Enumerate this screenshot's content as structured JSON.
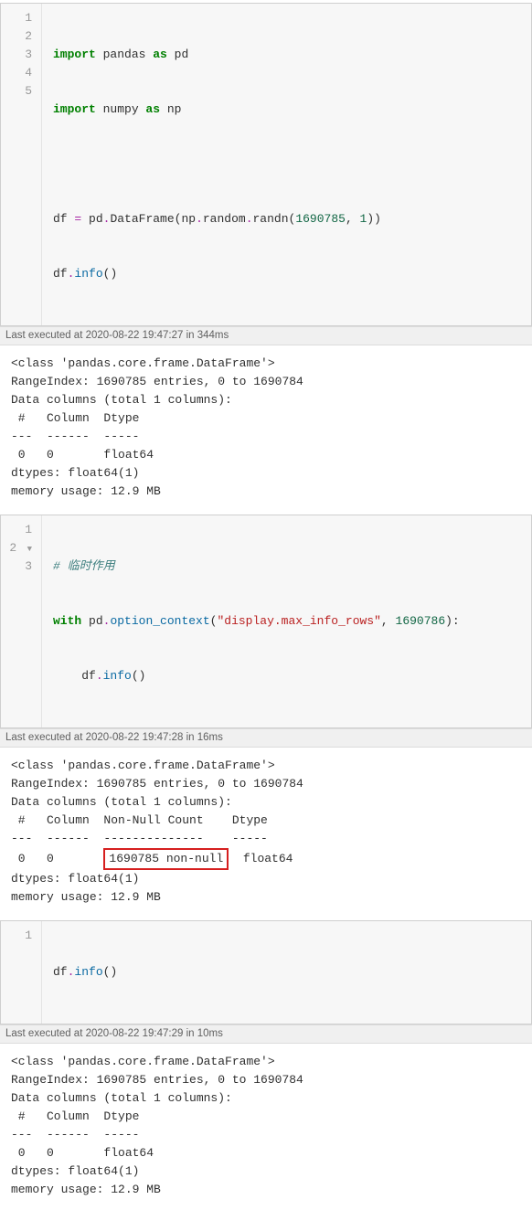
{
  "cell1": {
    "lines": [
      "1",
      "2",
      "3",
      "4",
      "5"
    ],
    "code": {
      "l1a": "import",
      "l1b": " pandas ",
      "l1c": "as",
      "l1d": " pd",
      "l2a": "import",
      "l2b": " numpy ",
      "l2c": "as",
      "l2d": " np",
      "l4a": "df ",
      "l4b": "=",
      "l4c": " pd",
      "l4d": ".",
      "l4e": "DataFrame",
      "l4f": "(np",
      "l4g": ".",
      "l4h": "random",
      "l4i": ".",
      "l4j": "randn",
      "l4k": "(",
      "l4l": "1690785",
      "l4m": ", ",
      "l4n": "1",
      "l4o": "))",
      "l5a": "df",
      "l5b": ".",
      "l5c": "info",
      "l5d": "()"
    },
    "exec": "Last executed at 2020-08-22 19:47:27 in 344ms",
    "output": "<class 'pandas.core.frame.DataFrame'>\nRangeIndex: 1690785 entries, 0 to 1690784\nData columns (total 1 columns):\n #   Column  Dtype  \n---  ------  -----  \n 0   0       float64\ndtypes: float64(1)\nmemory usage: 12.9 MB"
  },
  "cell2": {
    "lines": [
      "1",
      "2",
      "3"
    ],
    "fold": "▼",
    "code": {
      "l1": "# 临时作用",
      "l2a": "with",
      "l2b": " pd",
      "l2c": ".",
      "l2d": "option_context",
      "l2e": "(",
      "l2f": "\"display.max_info_rows\"",
      "l2g": ", ",
      "l2h": "1690786",
      "l2i": "):",
      "l3a": "    df",
      "l3b": ".",
      "l3c": "info",
      "l3d": "()"
    },
    "exec": "Last executed at 2020-08-22 19:47:28 in 16ms",
    "output_pre": "<class 'pandas.core.frame.DataFrame'>\nRangeIndex: 1690785 entries, 0 to 1690784\nData columns (total 1 columns):\n #   Column  Non-Null Count    Dtype  \n---  ------  --------------    -----  ",
    "output_row_a": " 0   0       ",
    "output_row_box": "1690785 non-null",
    "output_row_b": "  float64",
    "output_post": "dtypes: float64(1)\nmemory usage: 12.9 MB"
  },
  "cell3": {
    "lines": [
      "1"
    ],
    "code": {
      "l1a": "df",
      "l1b": ".",
      "l1c": "info",
      "l1d": "()"
    },
    "exec": "Last executed at 2020-08-22 19:47:29 in 10ms",
    "output": "<class 'pandas.core.frame.DataFrame'>\nRangeIndex: 1690785 entries, 0 to 1690784\nData columns (total 1 columns):\n #   Column  Dtype  \n---  ------  -----  \n 0   0       float64\ndtypes: float64(1)\nmemory usage: 12.9 MB"
  }
}
